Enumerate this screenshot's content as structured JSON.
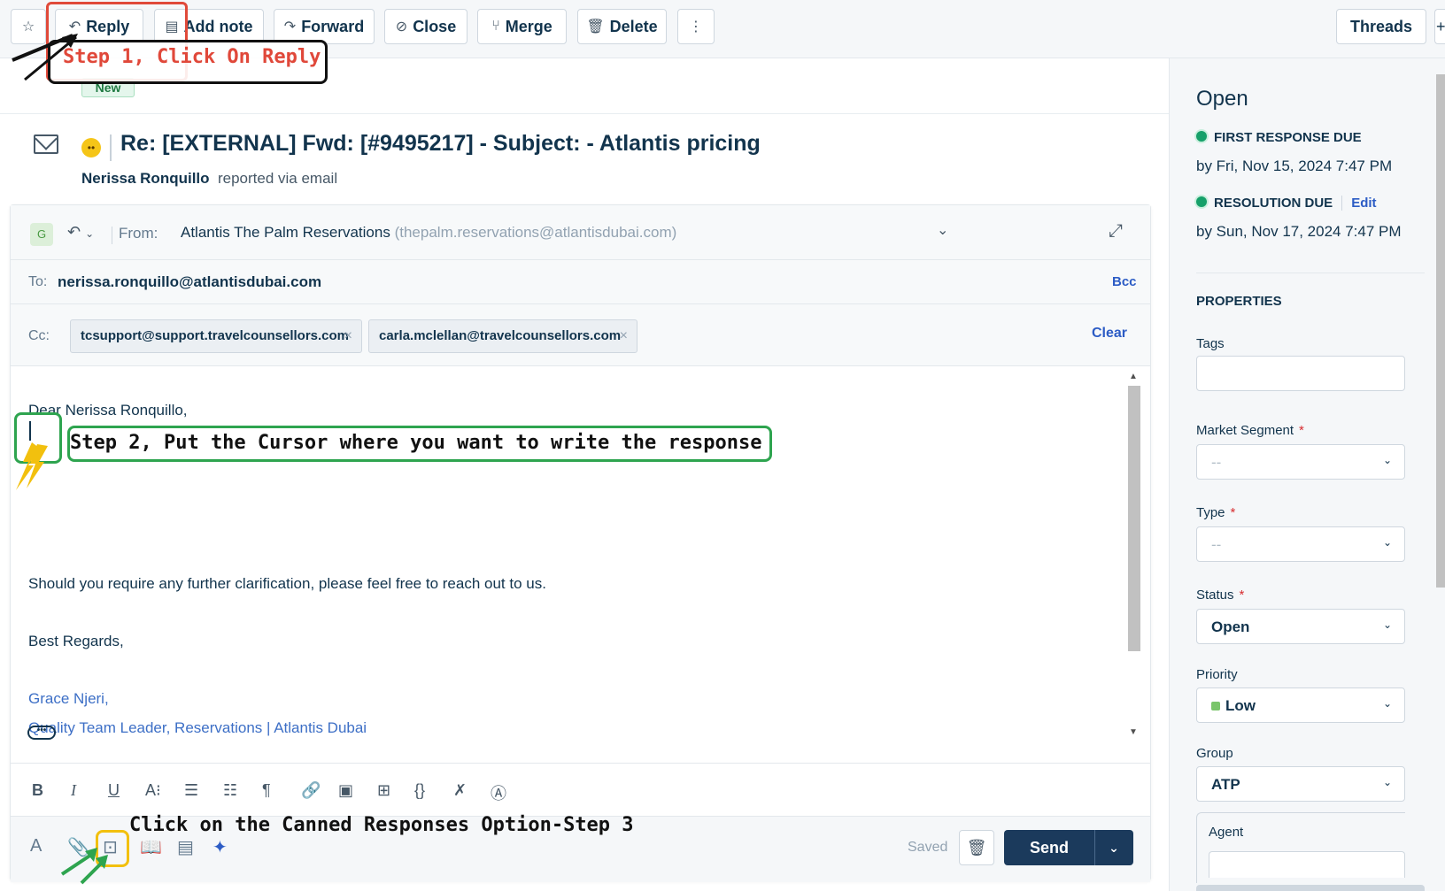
{
  "toolbar": {
    "reply": "Reply",
    "add_note": "Add note",
    "forward": "Forward",
    "close": "Close",
    "merge": "Merge",
    "delete": "Delete",
    "threads": "Threads"
  },
  "annotations": {
    "step1": "Step 1, Click On Reply",
    "step2": "Step 2, Put the Cursor where you want to write the response",
    "step3": "Click on the Canned Responses Option-Step 3"
  },
  "ticket": {
    "status_badge": "New",
    "title": "Re: [EXTERNAL] Fwd: [#9495217] - Subject: - Atlantis pricing",
    "reporter_name": "Nerissa Ronquillo",
    "reporter_via": "reported via email"
  },
  "compose": {
    "avatar_letter": "G",
    "from_label": "From:",
    "from_name": "Atlantis The Palm Reservations",
    "from_email": "(thepalm.reservations@atlantisdubai.com)",
    "to_label": "To:",
    "to_value": "nerissa.ronquillo@atlantisdubai.com",
    "bcc": "Bcc",
    "cc_label": "Cc:",
    "cc": [
      "tcsupport@support.travelcounsellors.com",
      "carla.mclellan@travelcounsellors.com"
    ],
    "clear": "Clear",
    "body": {
      "greeting": "Dear  Nerissa Ronquillo,",
      "clarification": "Should you require any further clarification, please feel free to reach out to us.",
      "regards": "Best Regards,",
      "sig_name": "Grace Njeri,",
      "sig_title": "Quality Team Leader, Reservations | Atlantis Dubai"
    },
    "saved": "Saved",
    "send": "Send"
  },
  "panel": {
    "status": "Open",
    "first_response_label": "FIRST RESPONSE DUE",
    "first_response_date": "by Fri, Nov 15, 2024 7:47 PM",
    "resolution_label": "RESOLUTION DUE",
    "resolution_edit": "Edit",
    "resolution_date": "by Sun, Nov 17, 2024 7:47 PM",
    "properties": "PROPERTIES",
    "tags_label": "Tags",
    "market_label": "Market Segment",
    "market_value": "--",
    "type_label": "Type",
    "type_value": "--",
    "status_label": "Status",
    "status_value": "Open",
    "priority_label": "Priority",
    "priority_value": "Low",
    "group_label": "Group",
    "group_value": "ATP",
    "agent_label": "Agent",
    "required_mark": "*"
  },
  "colors": {
    "primary_dark": "#1b3a5c",
    "link": "#2c5cc5",
    "sla_green": "#16a06a",
    "annotation_red": "#e04a3a",
    "annotation_green": "#2ea44f",
    "annotation_yellow": "#f2c00e"
  }
}
